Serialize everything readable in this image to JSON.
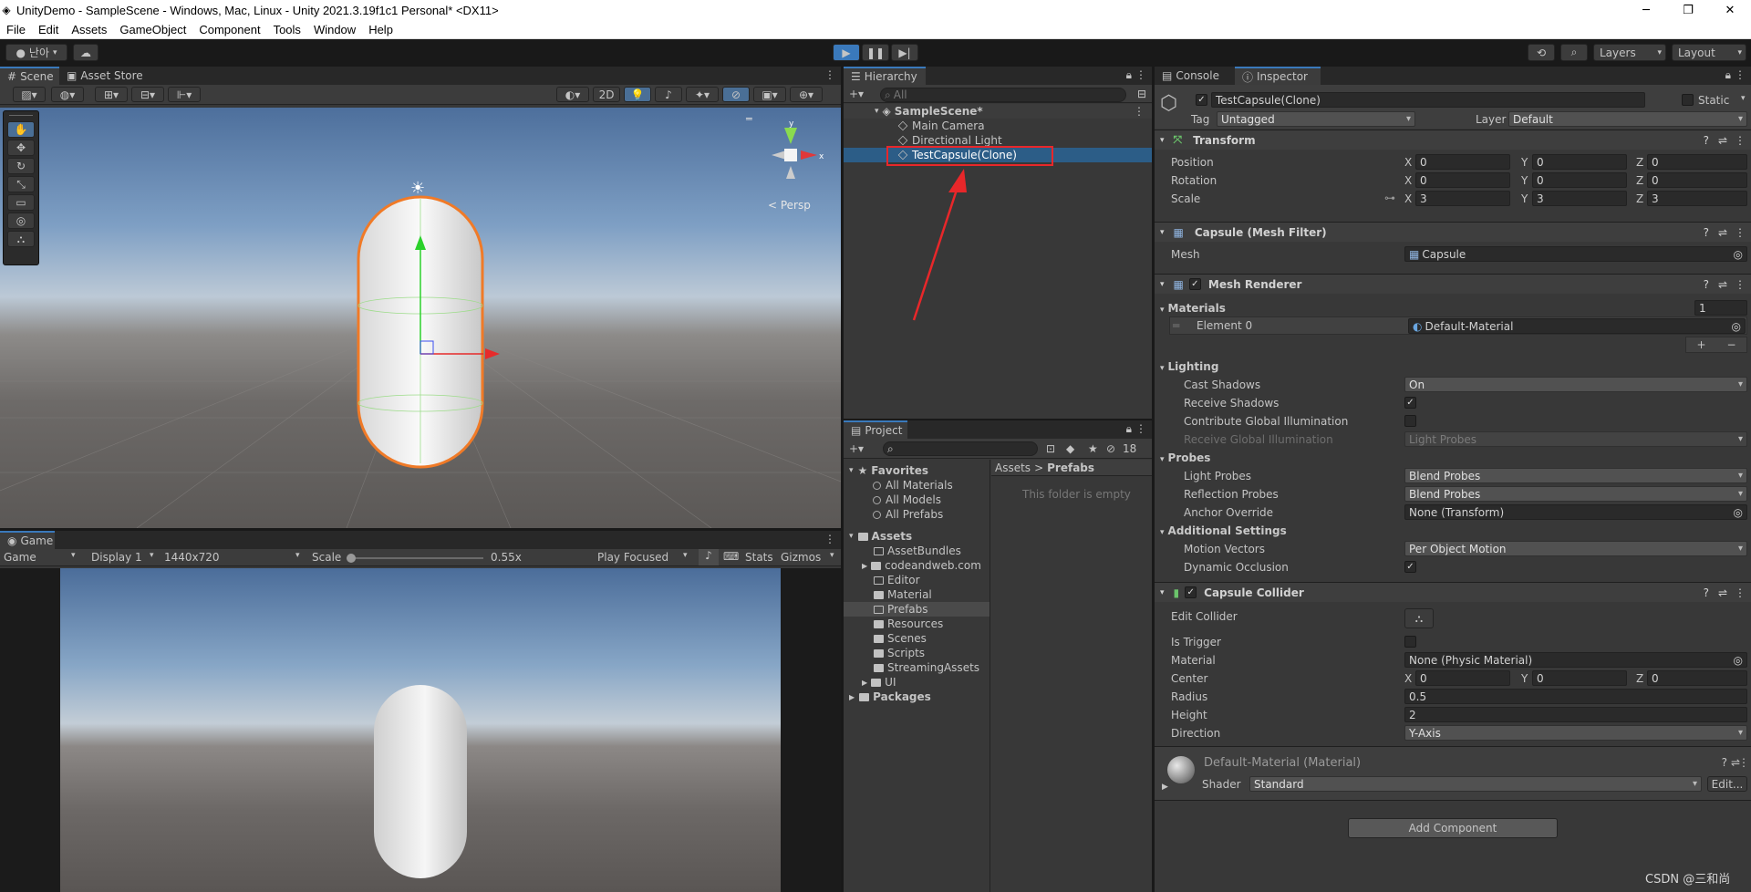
{
  "window": {
    "title": "UnityDemo - SampleScene - Windows, Mac, Linux - Unity 2021.3.19f1c1 Personal* <DX11>",
    "minimize": "─",
    "maximize": "❐",
    "close": "✕"
  },
  "menu": [
    "File",
    "Edit",
    "Assets",
    "GameObject",
    "Component",
    "Tools",
    "Window",
    "Help"
  ],
  "toolbar": {
    "account": "난아",
    "layers": "Layers",
    "layout": "Layout"
  },
  "scene_panel": {
    "tabs": [
      "Scene",
      "Asset Store"
    ],
    "mode_2d": "2D",
    "persp": "< Persp",
    "gizmo_y": "y",
    "gizmo_x": "x"
  },
  "game_panel": {
    "tab": "Game",
    "display": "Game",
    "display_num": "Display 1",
    "resolution": "1440x720",
    "scale_label": "Scale",
    "scale_value": "0.55x",
    "play_focused": "Play Focused",
    "stats": "Stats",
    "gizmos": "Gizmos"
  },
  "hierarchy": {
    "tab": "Hierarchy",
    "search_placeholder": "All",
    "scene": "SampleScene*",
    "items": [
      "Main Camera",
      "Directional Light",
      "TestCapsule(Clone)"
    ]
  },
  "project": {
    "tab": "Project",
    "count": "18",
    "favorites_label": "Favorites",
    "favorites": [
      "All Materials",
      "All Models",
      "All Prefabs"
    ],
    "assets_label": "Assets",
    "folders": [
      "AssetBundles",
      "codeandweb.com",
      "Editor",
      "Material",
      "Prefabs",
      "Resources",
      "Scenes",
      "Scripts",
      "StreamingAssets",
      "UI"
    ],
    "packages_label": "Packages",
    "breadcrumb_root": "Assets",
    "breadcrumb_sep": ">",
    "breadcrumb_current": "Prefabs",
    "empty_msg": "This folder is empty"
  },
  "inspector": {
    "tabs": [
      "Console",
      "Inspector"
    ],
    "object_name": "TestCapsule(Clone)",
    "static_label": "Static",
    "tag_label": "Tag",
    "tag_value": "Untagged",
    "layer_label": "Layer",
    "layer_value": "Default",
    "transform": {
      "title": "Transform",
      "position_label": "Position",
      "rotation_label": "Rotation",
      "scale_label": "Scale",
      "position": [
        "0",
        "0",
        "0"
      ],
      "rotation": [
        "0",
        "0",
        "0"
      ],
      "scale": [
        "3",
        "3",
        "3"
      ],
      "axes": [
        "X",
        "Y",
        "Z"
      ]
    },
    "mesh_filter": {
      "title": "Capsule (Mesh Filter)",
      "mesh_label": "Mesh",
      "mesh_value": "Capsule"
    },
    "mesh_renderer": {
      "title": "Mesh Renderer",
      "materials_label": "Materials",
      "materials_count": "1",
      "element_label": "Element 0",
      "element_value": "Default-Material",
      "add": "+",
      "remove": "−",
      "lighting_label": "Lighting",
      "cast_shadows_label": "Cast Shadows",
      "cast_shadows": "On",
      "receive_shadows_label": "Receive Shadows",
      "contrib_gi_label": "Contribute Global Illumination",
      "receive_gi_label": "Receive Global Illumination",
      "receive_gi_value": "Light Probes",
      "probes_label": "Probes",
      "light_probes_label": "Light Probes",
      "light_probes": "Blend Probes",
      "reflection_probes_label": "Reflection Probes",
      "reflection_probes": "Blend Probes",
      "anchor_label": "Anchor Override",
      "anchor_value": "None (Transform)",
      "additional_label": "Additional Settings",
      "motion_label": "Motion Vectors",
      "motion_value": "Per Object Motion",
      "occlusion_label": "Dynamic Occlusion"
    },
    "capsule_collider": {
      "title": "Capsule Collider",
      "edit_label": "Edit Collider",
      "trigger_label": "Is Trigger",
      "material_label": "Material",
      "material_value": "None (Physic Material)",
      "center_label": "Center",
      "center": [
        "0",
        "0",
        "0"
      ],
      "radius_label": "Radius",
      "radius": "0.5",
      "height_label": "Height",
      "height": "2",
      "direction_label": "Direction",
      "direction": "Y-Axis"
    },
    "material": {
      "title": "Default-Material (Material)",
      "shader_label": "Shader",
      "shader_value": "Standard",
      "edit": "Edit..."
    },
    "add_component": "Add Component"
  },
  "watermark": "CSDN @三和尚",
  "colors": {
    "selection": "#2c5d87",
    "highlight_box": "#e8272a",
    "accent_tab": "#3a79bb",
    "capsule_outline": "#f07a27"
  }
}
